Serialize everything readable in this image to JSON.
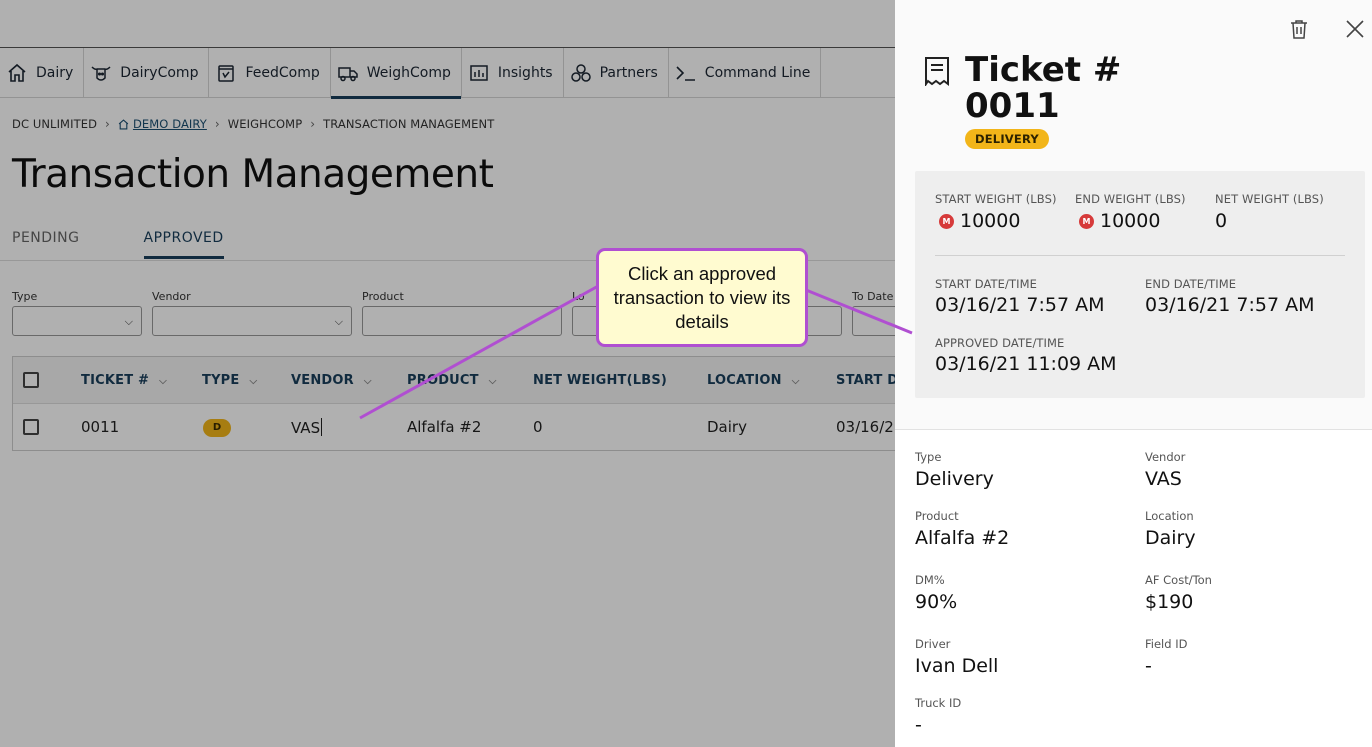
{
  "nav": {
    "items": [
      {
        "label": "Dairy",
        "icon": "home-icon"
      },
      {
        "label": "DairyComp",
        "icon": "cow-icon"
      },
      {
        "label": "FeedComp",
        "icon": "feed-icon"
      },
      {
        "label": "WeighComp",
        "icon": "truck-icon",
        "active": true
      },
      {
        "label": "Insights",
        "icon": "bar-chart-icon"
      },
      {
        "label": "Partners",
        "icon": "partners-icon"
      },
      {
        "label": "Command Line",
        "icon": "terminal-icon"
      }
    ]
  },
  "breadcrumb": {
    "root": "DC UNLIMITED",
    "farm": "DEMO DAIRY",
    "module": "WEIGHCOMP",
    "page": "TRANSACTION MANAGEMENT"
  },
  "page": {
    "title": "Transaction Management"
  },
  "tabs": {
    "pending": "PENDING",
    "approved": "APPROVED"
  },
  "filters": {
    "type": "Type",
    "vendor": "Vendor",
    "product": "Product",
    "location": "Lo",
    "to_date": "To Date"
  },
  "table": {
    "headers": {
      "ticket": "TICKET #",
      "type": "TYPE",
      "vendor": "VENDOR",
      "product": "PRODUCT",
      "net_weight": "NET WEIGHT(LBS)",
      "location": "LOCATION",
      "start_date": "START DA"
    },
    "rows": [
      {
        "ticket": "0011",
        "type": "D",
        "vendor": "VAS",
        "product": "Alfalfa #2",
        "net_weight": "0",
        "location": "Dairy",
        "start_date": "03/16/2"
      }
    ]
  },
  "callout": {
    "text": "Click an approved transaction to view its details"
  },
  "panel": {
    "title": "Ticket # 0011",
    "badge": "DELIVERY",
    "start_weight_label": "START WEIGHT (LBS)",
    "start_weight": "10000",
    "end_weight_label": "END WEIGHT (LBS)",
    "end_weight": "10000",
    "net_weight_label": "NET WEIGHT (LBS)",
    "net_weight": "0",
    "start_date_label": "START DATE/TIME",
    "start_date": "03/16/21 7:57 AM",
    "end_date_label": "END DATE/TIME",
    "end_date": "03/16/21 7:57 AM",
    "approved_date_label": "APPROVED DATE/TIME",
    "approved_date": "03/16/21 11:09 AM",
    "m_badge": "M",
    "details": {
      "type_label": "Type",
      "type": "Delivery",
      "vendor_label": "Vendor",
      "vendor": "VAS",
      "product_label": "Product",
      "product": "Alfalfa #2",
      "location_label": "Location",
      "location": "Dairy",
      "dm_label": "DM%",
      "dm": "90%",
      "af_cost_label": "AF Cost/Ton",
      "af_cost": "$190",
      "driver_label": "Driver",
      "driver": "Ivan Dell",
      "field_id_label": "Field ID",
      "field_id": "-",
      "truck_id_label": "Truck ID",
      "truck_id": "-"
    }
  },
  "colors": {
    "accent": "#1a3f5c",
    "badge_yellow": "#f2b519",
    "callout_border": "#b04fd1",
    "callout_bg": "#fffbd0",
    "scale_icon": "#d63a3a"
  }
}
